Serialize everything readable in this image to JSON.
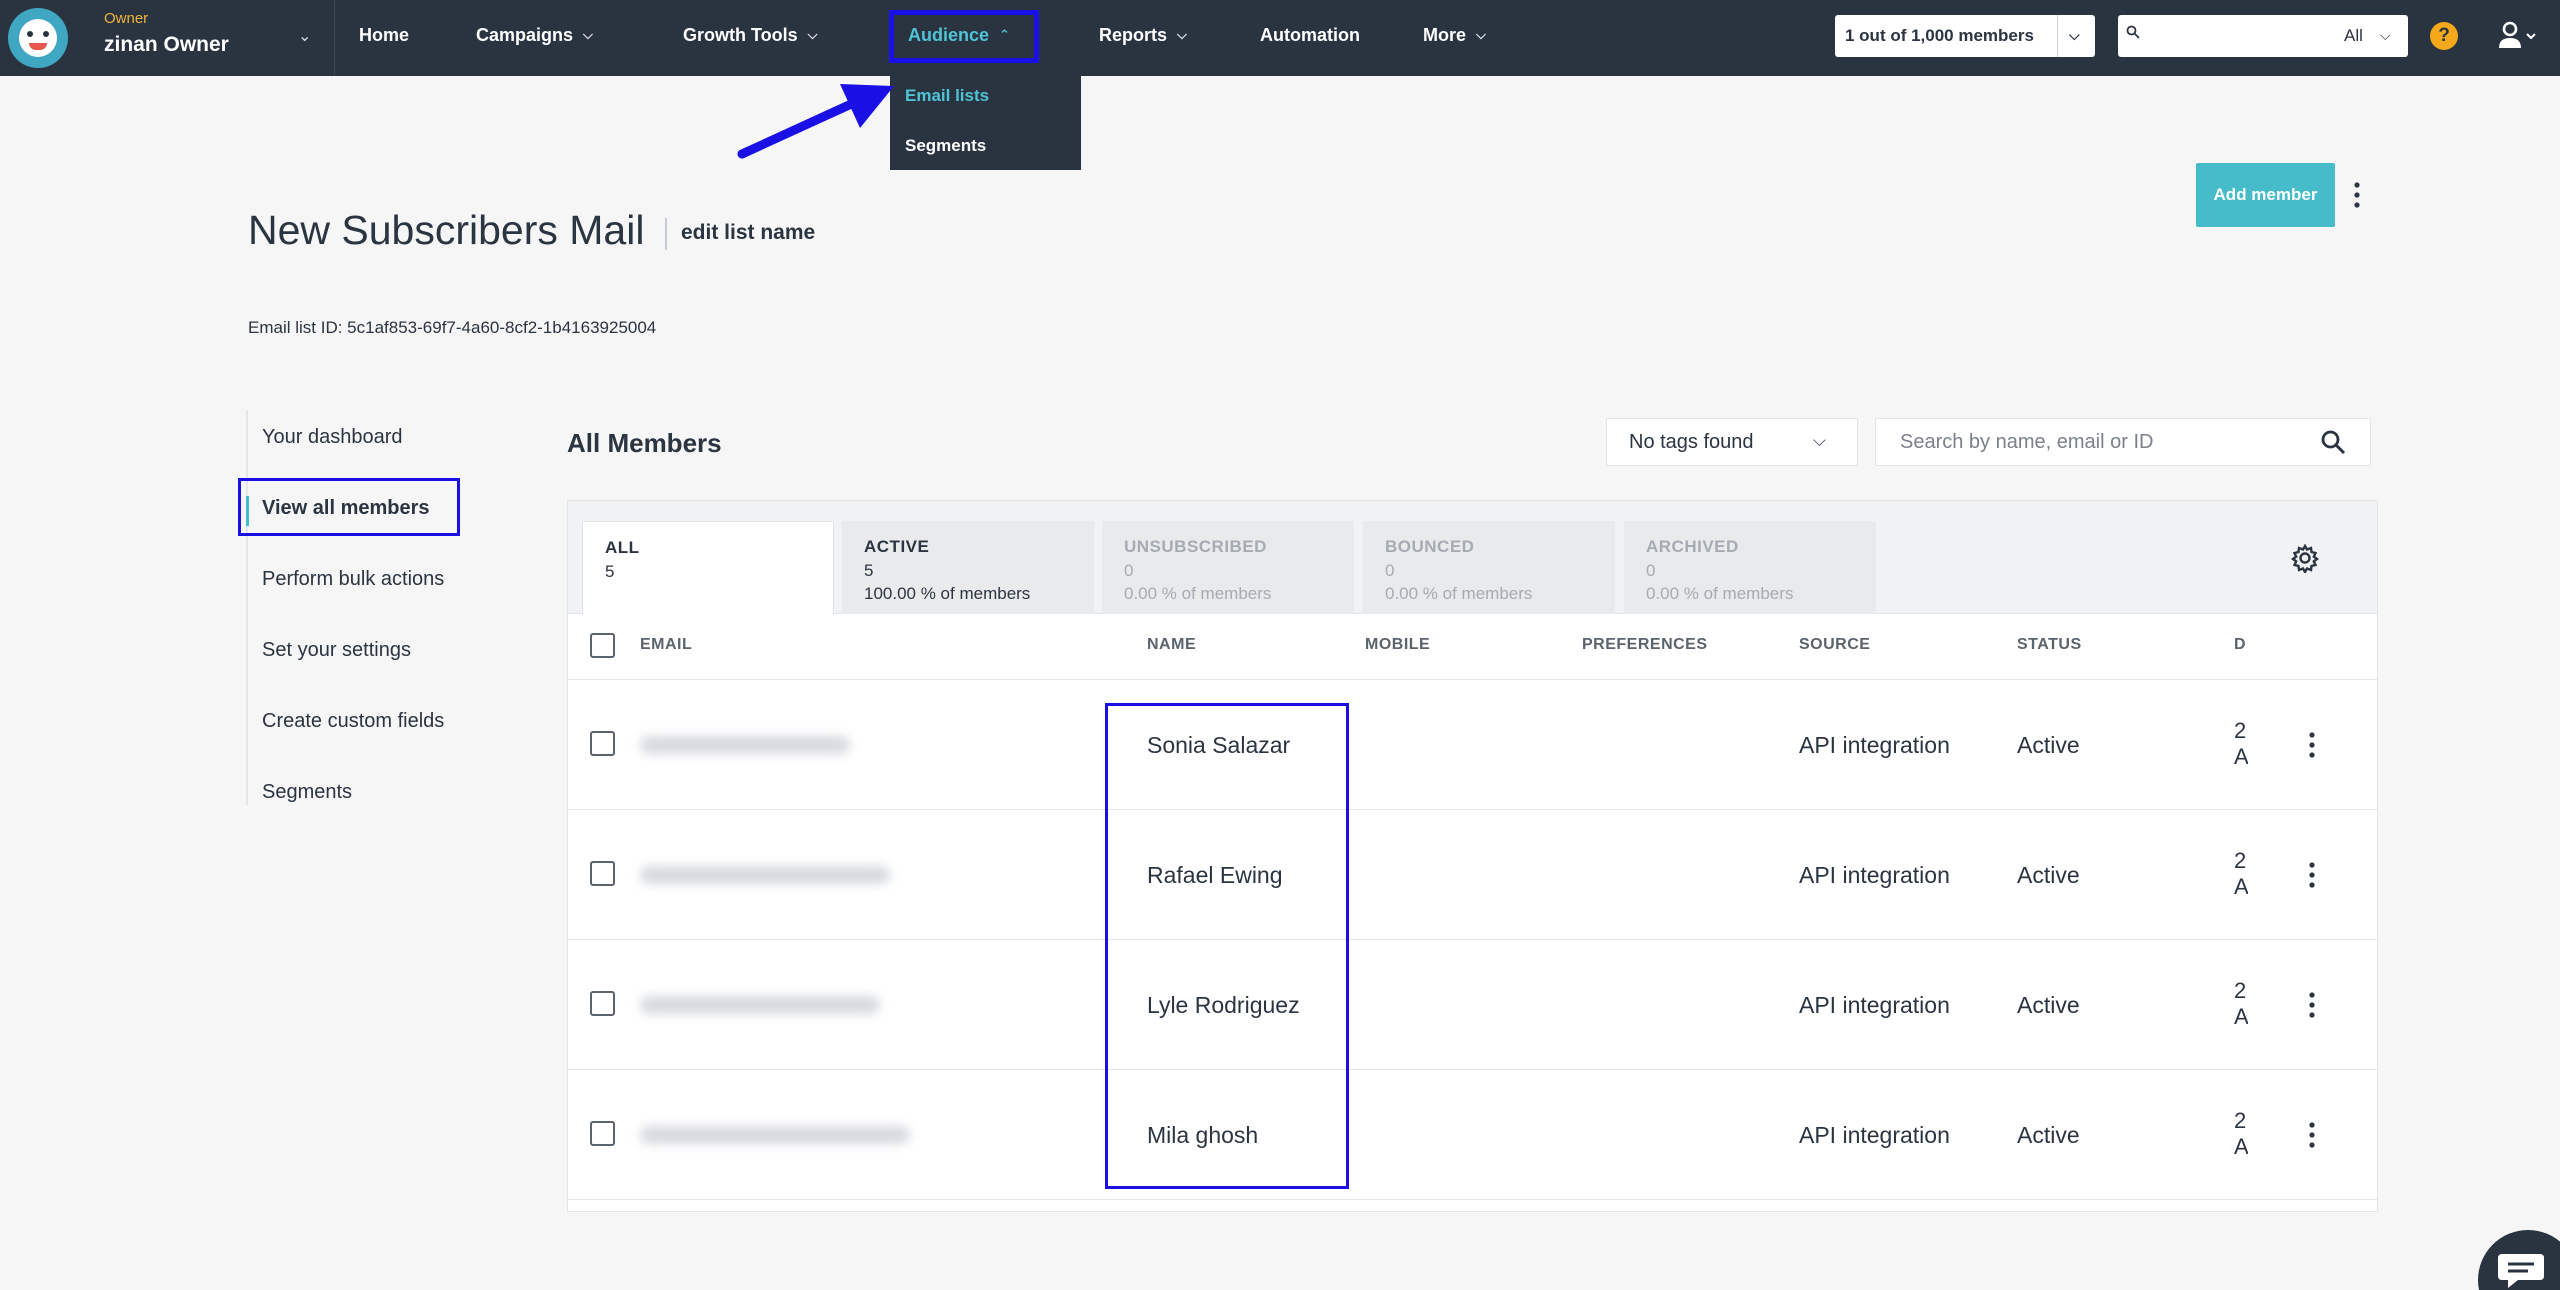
{
  "account": {
    "role": "Owner",
    "name": "zinan Owner"
  },
  "nav": {
    "home": "Home",
    "campaigns": "Campaigns",
    "growth_tools": "Growth Tools",
    "audience": "Audience",
    "reports": "Reports",
    "automation": "Automation",
    "more": "More"
  },
  "members_counter": "1 out of 1,000 members",
  "top_search": {
    "placeholder": "",
    "scope": "All"
  },
  "help": "?",
  "dropdown": {
    "email_lists": "Email lists",
    "segments": "Segments"
  },
  "header": {
    "add_member": "Add member",
    "title": "New Subscribers Mail",
    "edit_name": "edit list name",
    "list_id": "Email list ID: 5c1af853-69f7-4a60-8cf2-1b4163925004"
  },
  "side_menu": {
    "dashboard": "Your dashboard",
    "view_all": "View all members",
    "bulk": "Perform bulk actions",
    "settings": "Set your settings",
    "custom_fields": "Create custom fields",
    "segments": "Segments"
  },
  "members": {
    "title": "All Members",
    "tags": "No tags found",
    "search_placeholder": "Search by name, email or ID"
  },
  "tabs": [
    {
      "label": "ALL",
      "count": "5",
      "pct": ""
    },
    {
      "label": "ACTIVE",
      "count": "5",
      "pct": "100.00 % of members"
    },
    {
      "label": "UNSUBSCRIBED",
      "count": "0",
      "pct": "0.00 % of members"
    },
    {
      "label": "BOUNCED",
      "count": "0",
      "pct": "0.00 % of members"
    },
    {
      "label": "ARCHIVED",
      "count": "0",
      "pct": "0.00 % of members"
    }
  ],
  "columns": {
    "email": "EMAIL",
    "name": "NAME",
    "mobile": "MOBILE",
    "preferences": "PREFERENCES",
    "source": "SOURCE",
    "status": "STATUS",
    "date": "D"
  },
  "rows": [
    {
      "name": "Sonia Salazar",
      "source": "API integration",
      "status": "Active",
      "date": "2 A"
    },
    {
      "name": "Rafael Ewing",
      "source": "API integration",
      "status": "Active",
      "date": "2 A"
    },
    {
      "name": "Lyle Rodriguez",
      "source": "API integration",
      "status": "Active",
      "date": "2 A"
    },
    {
      "name": "Mila ghosh",
      "source": "API integration",
      "status": "Active",
      "date": "2 A"
    }
  ],
  "colors": {
    "accent": "#46bcca",
    "nav_bg": "#2a3441",
    "annotation": "#1a10e6",
    "help": "#f4a91b"
  }
}
